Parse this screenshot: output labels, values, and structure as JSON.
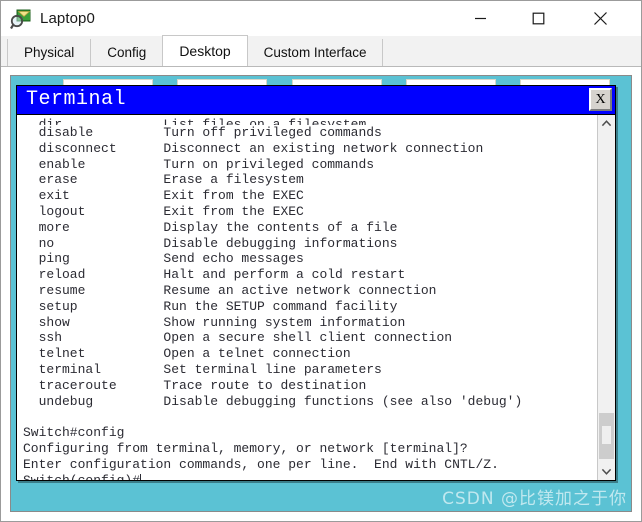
{
  "window": {
    "title": "Laptop0",
    "icon": "packet-tracer-laptop-icon",
    "controls": {
      "minimize": "—",
      "maximize": "☐",
      "close": "✕"
    }
  },
  "tabs": [
    {
      "label": "Physical",
      "active": false
    },
    {
      "label": "Config",
      "active": false
    },
    {
      "label": "Desktop",
      "active": true
    },
    {
      "label": "Custom Interface",
      "active": false
    }
  ],
  "desktop": {
    "background_color": "#5bc2d4"
  },
  "terminal": {
    "title": "Terminal",
    "close_label": "X",
    "lines": [
      {
        "text": "  dir             List files on a filesystem",
        "clipped": true
      },
      {
        "text": "  disable         Turn off privileged commands"
      },
      {
        "text": "  disconnect      Disconnect an existing network connection"
      },
      {
        "text": "  enable          Turn on privileged commands"
      },
      {
        "text": "  erase           Erase a filesystem"
      },
      {
        "text": "  exit            Exit from the EXEC"
      },
      {
        "text": "  logout          Exit from the EXEC"
      },
      {
        "text": "  more            Display the contents of a file"
      },
      {
        "text": "  no              Disable debugging informations"
      },
      {
        "text": "  ping            Send echo messages"
      },
      {
        "text": "  reload          Halt and perform a cold restart"
      },
      {
        "text": "  resume          Resume an active network connection"
      },
      {
        "text": "  setup           Run the SETUP command facility"
      },
      {
        "text": "  show            Show running system information"
      },
      {
        "text": "  ssh             Open a secure shell client connection"
      },
      {
        "text": "  telnet          Open a telnet connection"
      },
      {
        "text": "  terminal        Set terminal line parameters"
      },
      {
        "text": "  traceroute      Trace route to destination"
      },
      {
        "text": "  undebug         Disable debugging functions (see also 'debug')"
      },
      {
        "text": ""
      },
      {
        "text": "Switch#config"
      },
      {
        "text": "Configuring from terminal, memory, or network [terminal]? "
      },
      {
        "text": "Enter configuration commands, one per line.  End with CNTL/Z."
      },
      {
        "text": "Switch(config)#",
        "caret": true
      }
    ],
    "scrollbar": {
      "up_arrow": "˄",
      "down_arrow": "˅"
    }
  },
  "watermark": {
    "text": "CSDN @比镁加之于你"
  }
}
